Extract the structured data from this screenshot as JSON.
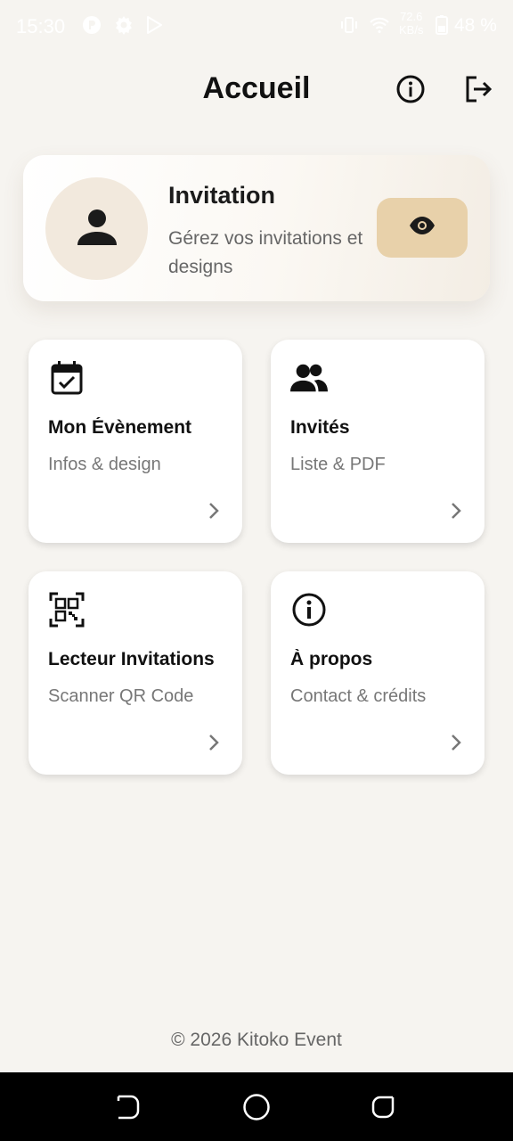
{
  "status_bar": {
    "time": "15:30",
    "net_speed_value": "72.6",
    "net_speed_unit": "KB/s",
    "battery": "48 %",
    "icons": [
      "app-notification-icon",
      "gear-icon",
      "play-store-icon",
      "vibrate-icon",
      "wifi-icon",
      "battery-icon"
    ]
  },
  "header": {
    "title": "Accueil",
    "info_icon": "info-icon",
    "logout_icon": "logout-icon"
  },
  "hero": {
    "title": "Invitation",
    "subtitle": "Gérez vos invitations et designs",
    "avatar_icon": "person-icon",
    "action_icon": "eye-icon",
    "accent": "#e8d1aa"
  },
  "tiles": [
    {
      "title": "Mon Évènement",
      "subtitle": "Infos & design",
      "icon": "calendar-check-icon"
    },
    {
      "title": "Invités",
      "subtitle": "Liste & PDF",
      "icon": "people-icon"
    },
    {
      "title": "Lecteur Invitations",
      "subtitle": "Scanner QR Code",
      "icon": "qr-code-icon"
    },
    {
      "title": "À propos",
      "subtitle": "Contact & crédits",
      "icon": "info-icon"
    }
  ],
  "footer": {
    "text": "© 2026 Kitoko Event"
  },
  "nav_bar": {
    "buttons": [
      "back-icon",
      "home-icon",
      "recents-icon"
    ]
  },
  "colors": {
    "background": "#f6f4f0",
    "card": "#ffffff",
    "accent": "#e8d1aa",
    "text": "#111111",
    "muted": "#777777"
  }
}
